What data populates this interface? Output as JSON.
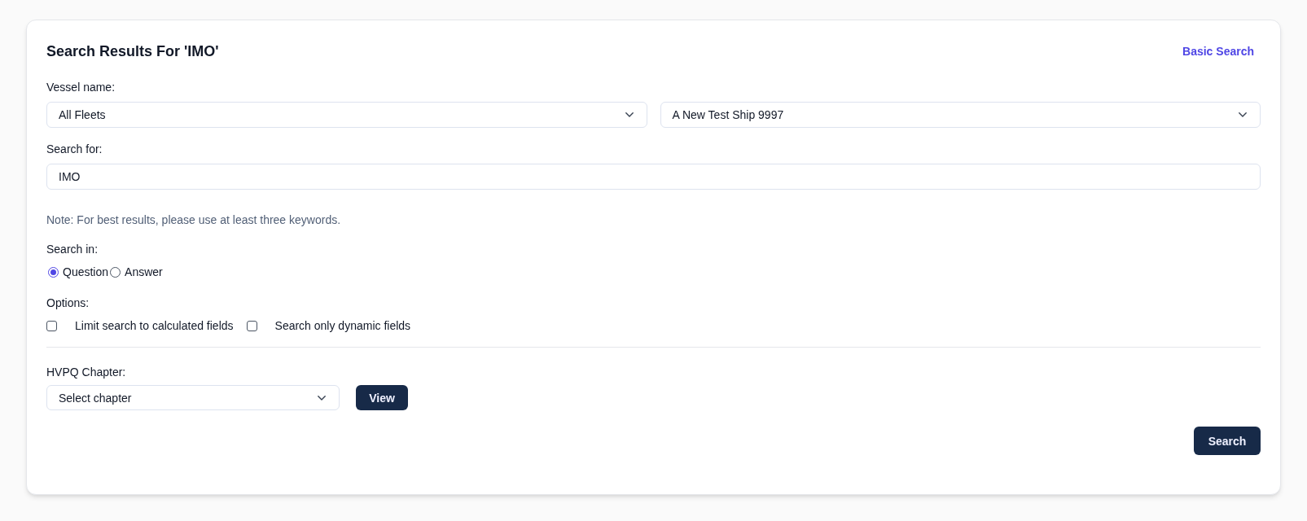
{
  "header": {
    "title": "Search Results For 'IMO'",
    "basic_search_link": "Basic Search"
  },
  "vessel": {
    "label": "Vessel name:",
    "fleet_select": {
      "value": "All Fleets"
    },
    "vessel_select": {
      "value": "A New Test Ship 9997"
    }
  },
  "search_for": {
    "label": "Search for:",
    "value": "IMO"
  },
  "note": "Note: For best results, please use at least three keywords.",
  "search_in": {
    "label": "Search in:",
    "options": [
      {
        "label": "Question",
        "selected": true
      },
      {
        "label": "Answer",
        "selected": false
      }
    ]
  },
  "options": {
    "label": "Options:",
    "checkboxes": [
      {
        "label": "Limit search to calculated fields",
        "checked": false
      },
      {
        "label": "Search only dynamic fields",
        "checked": false
      }
    ]
  },
  "chapter": {
    "label": "HVPQ Chapter:",
    "select": {
      "value": "Select chapter"
    },
    "view_button": "View"
  },
  "search_button": "Search"
}
